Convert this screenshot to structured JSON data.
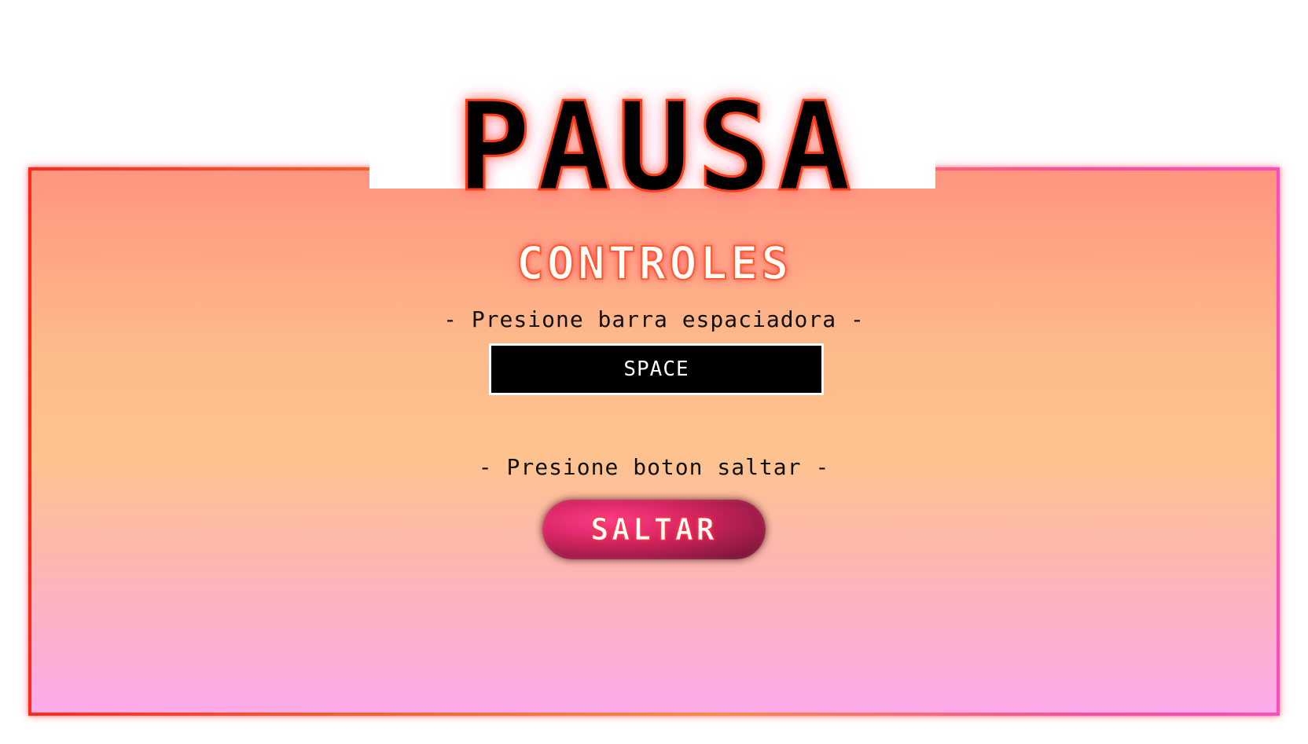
{
  "pause_title": "PAUSA",
  "controls_heading": "CONTROLES",
  "keyboard": {
    "instruction": "- Presione barra espaciadora -",
    "key_label": "SPACE"
  },
  "touch": {
    "instruction": "- Presione boton saltar -",
    "button_label": "SALTAR"
  },
  "colors": {
    "panel_top": "#ff9580",
    "panel_bottom": "#fcaaea",
    "border_left": "#ff2a1a",
    "border_right": "#ff4ac0",
    "jump_button": "#d2245f"
  }
}
